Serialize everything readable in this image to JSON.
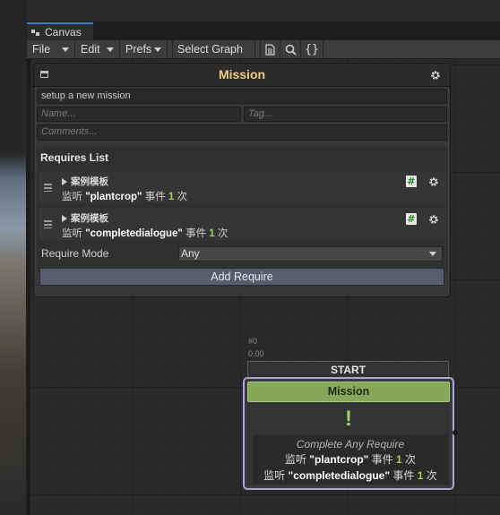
{
  "window": {
    "tab_title": "Canvas"
  },
  "toolbar": {
    "file": "File",
    "edit": "Edit",
    "prefs": "Prefs",
    "select_graph": "Select Graph",
    "icons": [
      "document-icon",
      "search-icon",
      "braces-icon"
    ],
    "braces_glyph": "{}"
  },
  "inspector": {
    "title": "Mission",
    "description_value": "setup a new mission",
    "name_placeholder": "Name...",
    "tag_placeholder": "Tag...",
    "comments_placeholder": "Comments...",
    "requires_title": "Requires List",
    "requires": [
      {
        "name": "案例模板",
        "prefix": "监听 ",
        "event": "\"plantcrop\"",
        "mid": " 事件 ",
        "count": "1",
        "suffix": " 次",
        "script_glyph": "#"
      },
      {
        "name": "案例模板",
        "prefix": "监听 ",
        "event": "\"completedialogue\"",
        "mid": " 事件 ",
        "count": "1",
        "suffix": " 次",
        "script_glyph": "#"
      }
    ],
    "require_mode_label": "Require Mode",
    "require_mode_value": "Any",
    "add_require_label": "Add Require"
  },
  "graph": {
    "start_node": {
      "id_label": "#0",
      "time_label": "0.00",
      "title": "START"
    },
    "mission_node": {
      "title": "Mission",
      "icon_glyph": "!",
      "mode_text": "Complete Any Require",
      "lines": [
        {
          "prefix": "监听 ",
          "event": "\"plantcrop\"",
          "mid": " 事件 ",
          "count": "1",
          "suffix": " 次"
        },
        {
          "prefix": "监听 ",
          "event": "\"completedialogue\"",
          "mid": " 事件 ",
          "count": "1",
          "suffix": " 次"
        }
      ]
    }
  },
  "colors": {
    "accent_title": "#f2cb7f",
    "node_header_green": "#86a85b",
    "selection_outline": "#a7a8d8",
    "count_green": "#a6d05a",
    "tab_accent": "#3a7dd8"
  }
}
